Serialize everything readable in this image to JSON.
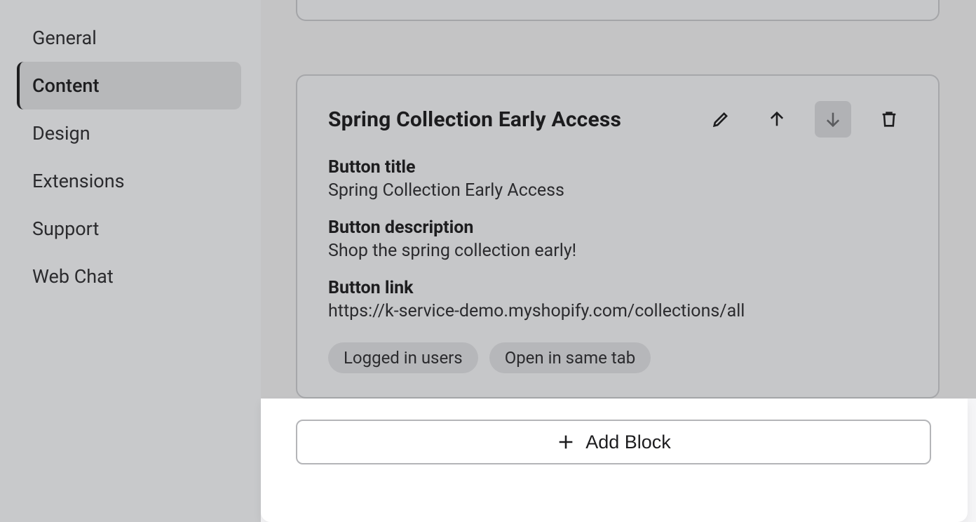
{
  "sidebar": {
    "items": [
      {
        "label": "General"
      },
      {
        "label": "Content"
      },
      {
        "label": "Design"
      },
      {
        "label": "Extensions"
      },
      {
        "label": "Support"
      },
      {
        "label": "Web Chat"
      }
    ],
    "active_index": 1
  },
  "card": {
    "title": "Spring Collection Early Access",
    "fields": [
      {
        "label": "Button title",
        "value": "Spring Collection Early Access"
      },
      {
        "label": "Button description",
        "value": "Shop the spring collection early!"
      },
      {
        "label": "Button link",
        "value": "https://k-service-demo.myshopify.com/collections/all"
      }
    ],
    "tags": [
      "Logged in users",
      "Open in same tab"
    ]
  },
  "add_block_label": "Add Block",
  "icons": {
    "edit": "pencil-icon",
    "move_up": "arrow-up-icon",
    "move_down": "arrow-down-icon",
    "delete": "trash-icon",
    "add": "plus-icon"
  }
}
